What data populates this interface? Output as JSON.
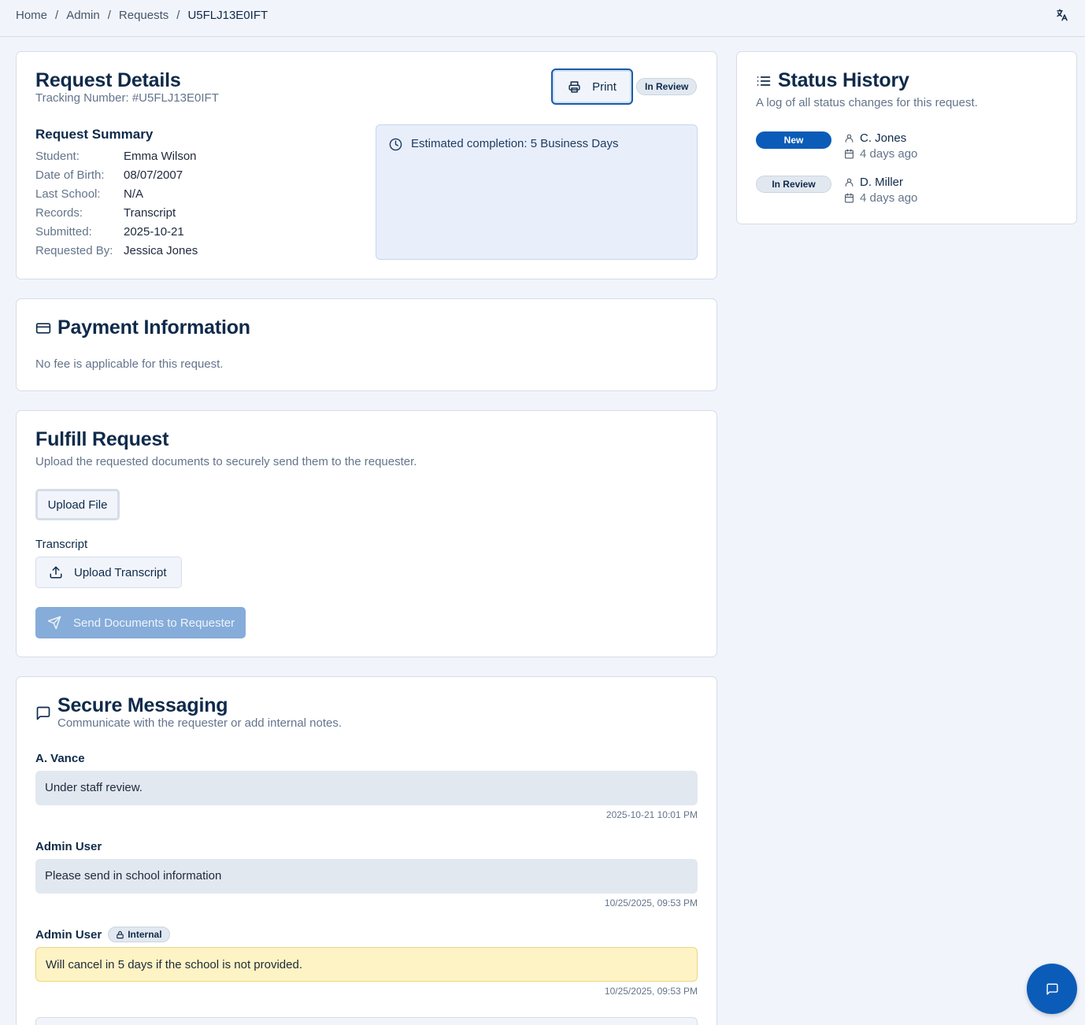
{
  "breadcrumb": {
    "home": "Home",
    "admin": "Admin",
    "requests": "Requests",
    "current": "U5FLJ13E0IFT",
    "separator": "/"
  },
  "details": {
    "title": "Request Details",
    "tracking": "Tracking Number: #U5FLJ13E0IFT",
    "print_label": "Print",
    "status_badge": "In Review",
    "summary_title": "Request Summary",
    "summary": [
      {
        "key": "Student:",
        "value": "Emma Wilson"
      },
      {
        "key": "Date of Birth:",
        "value": "08/07/2007"
      },
      {
        "key": "Last School:",
        "value": "N/A"
      },
      {
        "key": "Records:",
        "value": "Transcript"
      },
      {
        "key": "Submitted:",
        "value": "2025-10-21"
      },
      {
        "key": "Requested By:",
        "value": "Jessica Jones"
      }
    ],
    "estimate": "Estimated completion: 5 Business Days"
  },
  "payment": {
    "title": "Payment Information",
    "text": "No fee is applicable for this request."
  },
  "fulfill": {
    "title": "Fulfill Request",
    "subtitle": "Upload the requested documents to securely send them to the requester.",
    "upload_file_label": "Upload File",
    "transcript_label": "Transcript",
    "upload_transcript_label": "Upload Transcript",
    "send_label": "Send Documents to Requester"
  },
  "messaging": {
    "title": "Secure Messaging",
    "subtitle": "Communicate with the requester or add internal notes.",
    "internal_label": "Internal",
    "messages": [
      {
        "author": "A. Vance",
        "text": "Under staff review.",
        "time": "2025-10-21 10:01 PM"
      },
      {
        "author": "Admin User",
        "text": "Please send in school information",
        "time": "10/25/2025, 09:53 PM"
      },
      {
        "author": "Admin User",
        "text": "Will cancel in 5 days if the school is not provided.",
        "time": "10/25/2025, 09:53 PM"
      }
    ]
  },
  "history": {
    "title": "Status History",
    "subtitle": "A log of all status changes for this request.",
    "items": [
      {
        "status": "New",
        "who": "C. Jones",
        "when": "4 days ago"
      },
      {
        "status": "In Review",
        "who": "D. Miller",
        "when": "4 days ago"
      }
    ]
  },
  "colors": {
    "primary": "#0b5cb8",
    "heading": "#0f2a4a",
    "background": "#f1f5fb",
    "internal_note": "#fdf3c4"
  },
  "icons": {
    "translate": "translate-icon",
    "print": "printer-icon",
    "clock": "clock-icon",
    "payment": "credit-card-icon",
    "upload": "upload-icon",
    "send": "send-icon",
    "message": "message-square-icon",
    "history": "list-icon",
    "user": "user-icon",
    "calendar": "calendar-icon",
    "lock": "lock-icon",
    "chat_fab": "chat-icon"
  }
}
